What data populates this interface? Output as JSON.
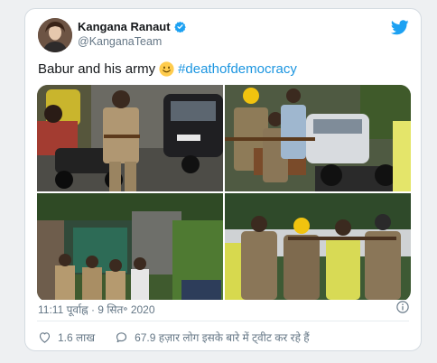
{
  "tweet": {
    "author_name": "Kangana Ranaut",
    "author_handle": "@KanganaTeam",
    "verified": true,
    "text_before": "Babur and his army",
    "emoji": "smiling-face",
    "hashtag": "#deathofdemocracy",
    "timestamp": "11:11 पूर्वाह्न · 9 सित॰ 2020",
    "likes": "1.6 लाख",
    "conversation": "67.9 हज़ार लोग इसके बारे में ट्वीट कर रहे हैं",
    "photos": [
      {
        "scene": "police officer near motorbikes on a street"
      },
      {
        "scene": "workers in helmets and police beside a car"
      },
      {
        "scene": "police officers at a gate surrounded by trees"
      },
      {
        "scene": "workers in yellow helmets carrying a tool"
      }
    ]
  },
  "colors": {
    "accent": "#1da1f2",
    "link": "#1b95e0",
    "text": "#14171a",
    "muted": "#657786",
    "border": "#d4dbe1"
  },
  "icons": [
    "twitter-bird-icon",
    "verified-badge-icon",
    "info-icon",
    "heart-icon",
    "comment-icon"
  ]
}
